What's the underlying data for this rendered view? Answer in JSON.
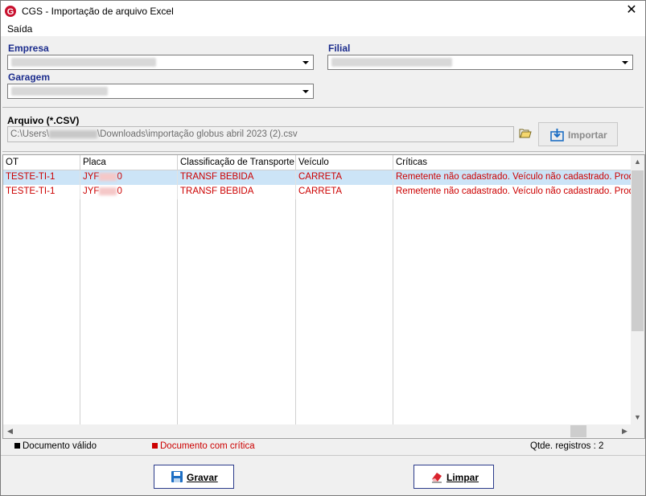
{
  "window": {
    "title": "CGS - Importação de arquivo Excel",
    "close_symbol": "✕"
  },
  "menu": {
    "items": [
      "Saída"
    ]
  },
  "form": {
    "empresa_label": "Empresa",
    "filial_label": "Filial",
    "garagem_label": "Garagem"
  },
  "file": {
    "label": "Arquivo (*.CSV)",
    "path_prefix": "C:\\Users\\",
    "path_suffix": "\\Downloads\\importação globus abril 2023 (2).csv",
    "import_label": "Importar"
  },
  "grid": {
    "columns": [
      "OT",
      "Placa",
      "Classificação de Transporte",
      "Veículo",
      "Críticas"
    ],
    "rows": [
      {
        "ot": "TESTE-TI-1",
        "placa_start": "JYF",
        "placa_end": "0",
        "classificacao": "TRANSF BEBIDA",
        "veiculo": "CARRETA",
        "criticas": "Remetente não cadastrado. Veículo não cadastrado. Produt...",
        "selected": true
      },
      {
        "ot": "TESTE-TI-1",
        "placa_start": "JYF",
        "placa_end": "0",
        "classificacao": "TRANSF BEBIDA",
        "veiculo": "CARRETA",
        "criticas": "Remetente não cadastrado. Veículo não cadastrado. Produt...",
        "selected": false
      }
    ]
  },
  "status": {
    "valid_label": "Documento válido",
    "critica_label": "Documento com crítica",
    "count_label": "Qtde. registros : 2"
  },
  "actions": {
    "gravar_label": "Gravar",
    "limpar_label": "Limpar"
  },
  "colors": {
    "label_blue": "#1a2b8c",
    "error_red": "#cc0000",
    "selected_row": "#cce4f7"
  }
}
